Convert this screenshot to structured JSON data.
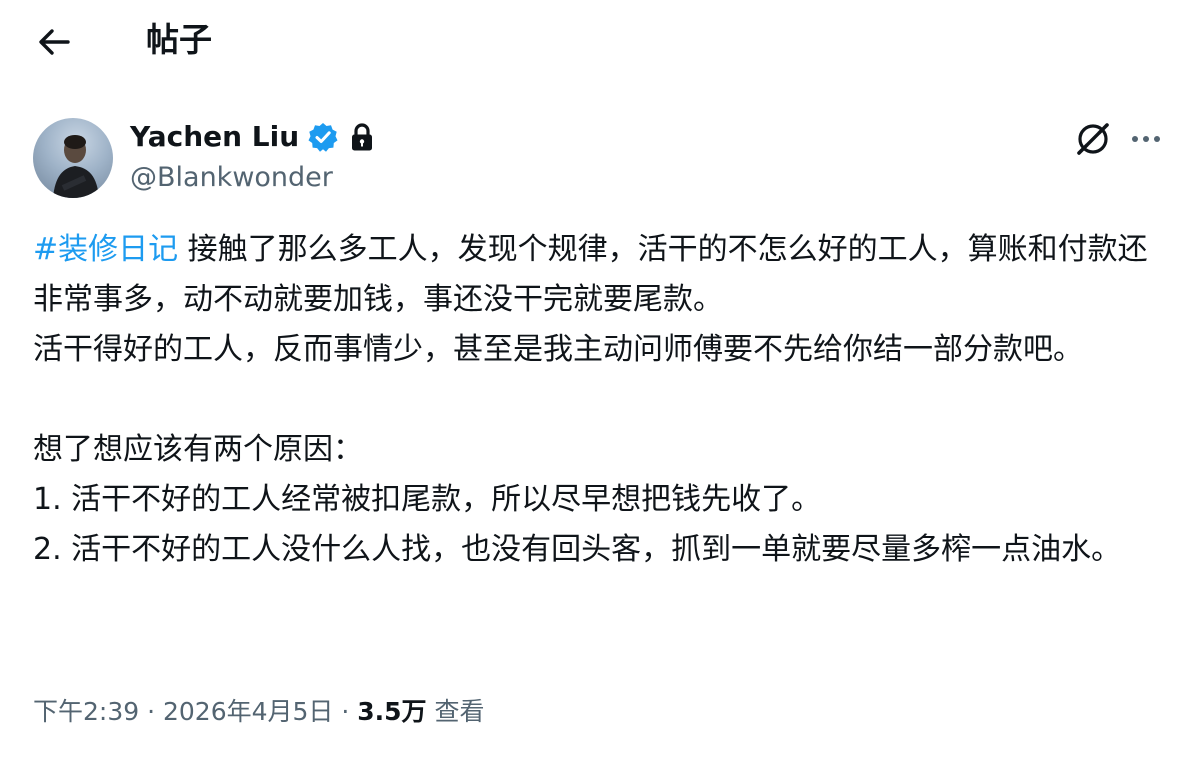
{
  "header": {
    "title": "帖子",
    "back_icon": "arrow-left-icon"
  },
  "author": {
    "display_name": "Yachen Liu",
    "handle": "@Blankwonder",
    "verified_icon": "verified-badge-icon",
    "protected_icon": "lock-icon",
    "verified_color": "#1d9bf0"
  },
  "actions": {
    "grok_icon": "grok-icon",
    "more_icon": "more-horizontal-icon"
  },
  "post": {
    "hashtag": "#装修日记",
    "text_after_hashtag": " 接触了那么多工人，发现个规律，活干的不怎么好的工人，算账和付款还非常事多，动不动就要加钱，事还没干完就要尾款。\n活干得好的工人，反而事情少，甚至是我主动问师傅要不先给你结一部分款吧。\n\n想了想应该有两个原因：\n1. 活干不好的工人经常被扣尾款，所以尽早想把钱先收了。\n2. 活干不好的工人没什么人找，也没有回头客，抓到一单就要尽量多榨一点油水。"
  },
  "meta": {
    "time": "下午2:39",
    "sep1": " · ",
    "date": "2026年4月5日",
    "sep2": " · ",
    "views_count": "3.5万",
    "views_label": " 查看"
  },
  "colors": {
    "text": "#0f1419",
    "secondary": "#536471",
    "accent": "#1d9bf0"
  }
}
